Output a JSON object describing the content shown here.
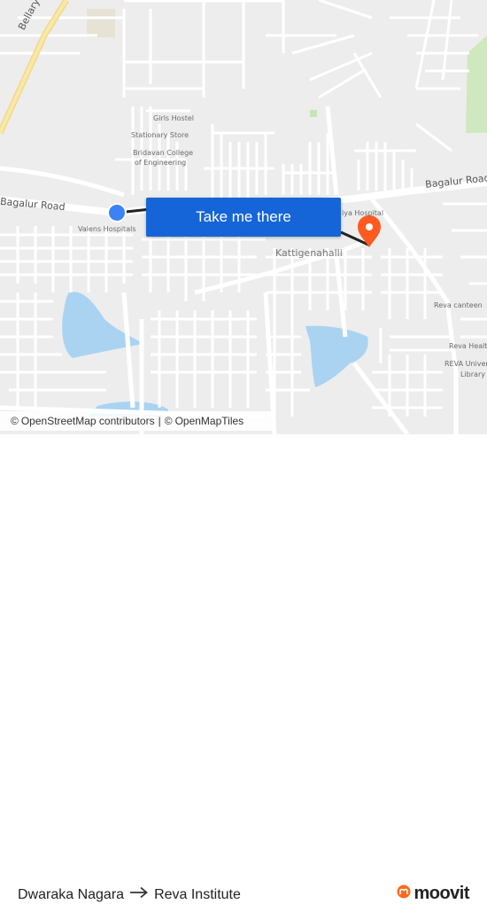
{
  "map": {
    "cta_label": "Take me there",
    "roads": {
      "bellary_road": "Bellary Road",
      "bagalur_road_west": "Bagalur Road",
      "bagalur_road_east": "Bagalur Road"
    },
    "places": {
      "girls_hostel": "Girls Hostel",
      "stationary_store": "Stationary Store",
      "bridavan_college_line1": "Bridavan College",
      "bridavan_college_line2": "of Engineering",
      "valens_hospitals": "Valens Hospitals",
      "hospital_partial": "iya Hospital",
      "kattigenahalli": "Kattigenahalli",
      "reva_canteen": "Reva canteen",
      "reva_health_partial": "Reva Healt",
      "reva_library_line1": "REVA Univer",
      "reva_library_line2": "Library"
    },
    "attribution": {
      "copyright": "©",
      "osm": "OpenStreetMap contributors",
      "separator": "|",
      "copyright2": "©",
      "omt": "OpenMapTiles"
    },
    "origin_marker_icon": "blue-dot-icon",
    "destination_marker_icon": "orange-pin-icon"
  },
  "footer": {
    "origin": "Dwaraka Nagara",
    "destination": "Reva Institute",
    "brand": "moovit",
    "arrow_icon": "arrow-right-icon"
  },
  "colors": {
    "map_background": "#ededed",
    "road": "#ffffff",
    "major_road": "#f7e08a",
    "water": "#aad3f2",
    "park": "#c8e6b4",
    "route_line": "#222222",
    "cta": "#1565d8",
    "origin_marker": "#3b82f6",
    "destination_marker": "#ff5a1f",
    "brand_accent": "#ff6a1a"
  }
}
